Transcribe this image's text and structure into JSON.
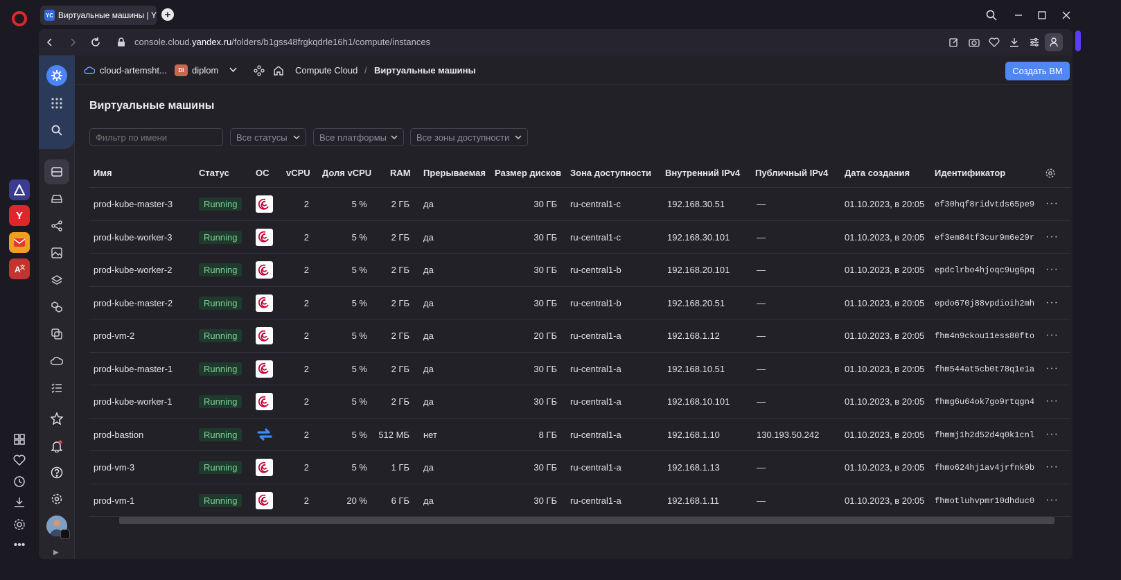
{
  "browser": {
    "tab_title": "Виртуальные машины | Y",
    "tab_favicon": "YC",
    "url_prefix": "console.cloud.",
    "url_domain": "yandex.ru",
    "url_path": "/folders/b1gss48frgkqdrle16h1/compute/instances",
    "sidebar_apps": [
      "aria-icon",
      "yandex-icon",
      "mail-icon",
      "translate-icon"
    ]
  },
  "header": {
    "cloud": "cloud-artemsht...",
    "folder_badge": "DI",
    "folder": "diplom",
    "service": "Compute Cloud",
    "separator": "/",
    "page": "Виртуальные машины",
    "create_button": "Создать ВМ"
  },
  "main": {
    "title": "Виртуальные машины",
    "filter_placeholder": "Фильтр по имени",
    "status_select": "Все статусы",
    "platform_select": "Все платформы",
    "zone_select": "Все зоны доступности"
  },
  "table": {
    "columns": {
      "name": "Имя",
      "status": "Статус",
      "os": "ОС",
      "vcpu": "vCPU",
      "share": "Доля vCPU",
      "ram": "RAM",
      "preemptible": "Прерываемая",
      "disk": "Размер дисков",
      "zone": "Зона доступности",
      "internal_ip": "Внутренний IPv4",
      "public_ip": "Публичный IPv4",
      "created": "Дата создания",
      "id": "Идентификатор"
    },
    "rows": [
      {
        "name": "prod-kube-master-3",
        "status": "Running",
        "os": "debian",
        "vcpu": "2",
        "share": "5 %",
        "ram": "2 ГБ",
        "preemptible": "да",
        "disk": "30 ГБ",
        "zone": "ru-central1-c",
        "internal_ip": "192.168.30.51",
        "public_ip": "—",
        "created": "01.10.2023, в 20:05",
        "id": "ef30hqf8ridvtds65pe9"
      },
      {
        "name": "prod-kube-worker-3",
        "status": "Running",
        "os": "debian",
        "vcpu": "2",
        "share": "5 %",
        "ram": "2 ГБ",
        "preemptible": "да",
        "disk": "30 ГБ",
        "zone": "ru-central1-c",
        "internal_ip": "192.168.30.101",
        "public_ip": "—",
        "created": "01.10.2023, в 20:05",
        "id": "ef3em84tf3cur9m6e29r"
      },
      {
        "name": "prod-kube-worker-2",
        "status": "Running",
        "os": "debian",
        "vcpu": "2",
        "share": "5 %",
        "ram": "2 ГБ",
        "preemptible": "да",
        "disk": "30 ГБ",
        "zone": "ru-central1-b",
        "internal_ip": "192.168.20.101",
        "public_ip": "—",
        "created": "01.10.2023, в 20:05",
        "id": "epdclrbo4hjoqc9ug6pq"
      },
      {
        "name": "prod-kube-master-2",
        "status": "Running",
        "os": "debian",
        "vcpu": "2",
        "share": "5 %",
        "ram": "2 ГБ",
        "preemptible": "да",
        "disk": "30 ГБ",
        "zone": "ru-central1-b",
        "internal_ip": "192.168.20.51",
        "public_ip": "—",
        "created": "01.10.2023, в 20:05",
        "id": "epdo670j88vpdioih2mh"
      },
      {
        "name": "prod-vm-2",
        "status": "Running",
        "os": "debian",
        "vcpu": "2",
        "share": "5 %",
        "ram": "2 ГБ",
        "preemptible": "да",
        "disk": "20 ГБ",
        "zone": "ru-central1-a",
        "internal_ip": "192.168.1.12",
        "public_ip": "—",
        "created": "01.10.2023, в 20:05",
        "id": "fhm4n9ckou11ess80fto"
      },
      {
        "name": "prod-kube-master-1",
        "status": "Running",
        "os": "debian",
        "vcpu": "2",
        "share": "5 %",
        "ram": "2 ГБ",
        "preemptible": "да",
        "disk": "30 ГБ",
        "zone": "ru-central1-a",
        "internal_ip": "192.168.10.51",
        "public_ip": "—",
        "created": "01.10.2023, в 20:05",
        "id": "fhm544at5cb0t78q1e1a"
      },
      {
        "name": "prod-kube-worker-1",
        "status": "Running",
        "os": "debian",
        "vcpu": "2",
        "share": "5 %",
        "ram": "2 ГБ",
        "preemptible": "да",
        "disk": "30 ГБ",
        "zone": "ru-central1-a",
        "internal_ip": "192.168.10.101",
        "public_ip": "—",
        "created": "01.10.2023, в 20:05",
        "id": "fhmg6u64ok7go9rtqgn4"
      },
      {
        "name": "prod-bastion",
        "status": "Running",
        "os": "nat",
        "vcpu": "2",
        "share": "5 %",
        "ram": "512 МБ",
        "preemptible": "нет",
        "disk": "8 ГБ",
        "zone": "ru-central1-a",
        "internal_ip": "192.168.1.10",
        "public_ip": "130.193.50.242",
        "created": "01.10.2023, в 20:05",
        "id": "fhmmj1h2d52d4q0k1cnl"
      },
      {
        "name": "prod-vm-3",
        "status": "Running",
        "os": "debian",
        "vcpu": "2",
        "share": "5 %",
        "ram": "1 ГБ",
        "preemptible": "да",
        "disk": "30 ГБ",
        "zone": "ru-central1-a",
        "internal_ip": "192.168.1.13",
        "public_ip": "—",
        "created": "01.10.2023, в 20:05",
        "id": "fhmo624hj1av4jrfnk9b"
      },
      {
        "name": "prod-vm-1",
        "status": "Running",
        "os": "debian",
        "vcpu": "2",
        "share": "20 %",
        "ram": "6 ГБ",
        "preemptible": "да",
        "disk": "30 ГБ",
        "zone": "ru-central1-a",
        "internal_ip": "192.168.1.11",
        "public_ip": "—",
        "created": "01.10.2023, в 20:05",
        "id": "fhmotluhvpmr10dhduc0"
      }
    ]
  },
  "colors": {
    "accent": "#4f87f5",
    "running_bg": "#1f3a2c",
    "running_text": "#7fcf95",
    "opera_red": "#e0262d"
  }
}
